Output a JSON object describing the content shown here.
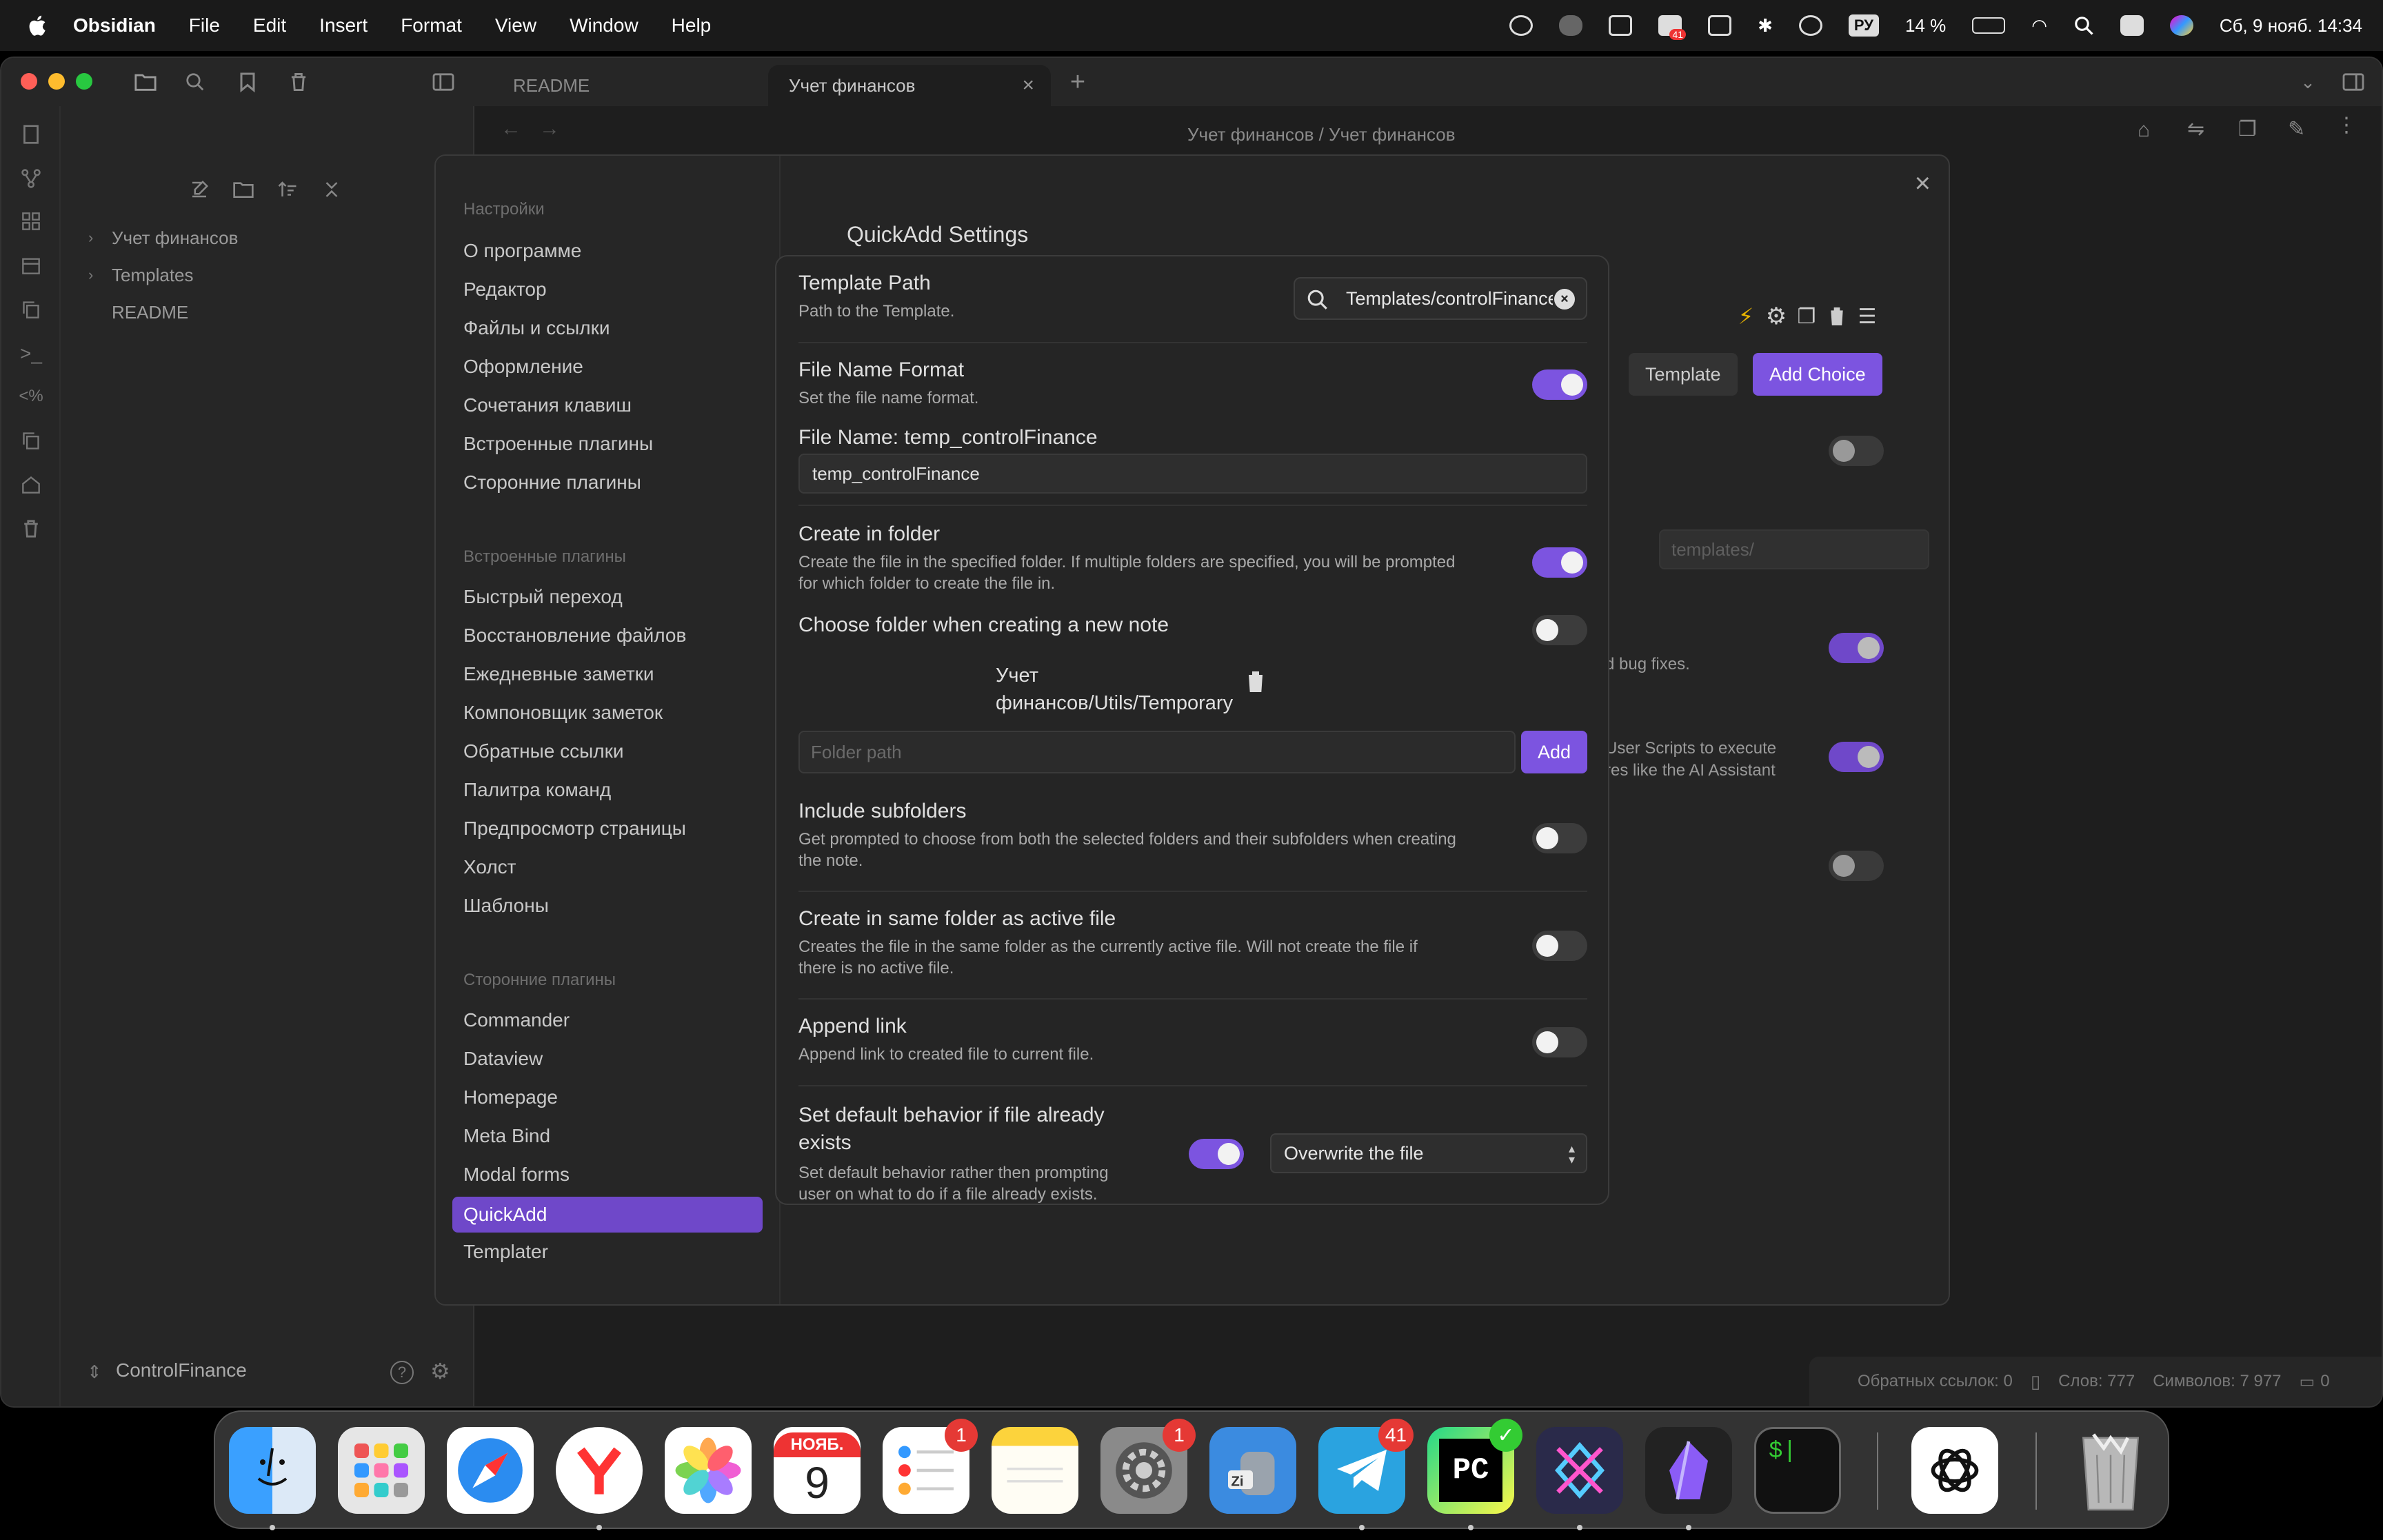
{
  "menubar": {
    "app": "Obsidian",
    "items": [
      "File",
      "Edit",
      "Insert",
      "Format",
      "View",
      "Window",
      "Help"
    ],
    "input_lang": "РУ",
    "battery": "14 %",
    "datetime": "Сб, 9 нояб.  14:34",
    "status_badge": "41"
  },
  "tabs": [
    {
      "label": "README",
      "active": false
    },
    {
      "label": "Учет финансов",
      "active": true
    }
  ],
  "breadcrumb": "Учет финансов  /  Учет финансов",
  "file_tree": {
    "items": [
      "Учет финансов",
      "Templates",
      "README"
    ],
    "vault": "ControlFinance"
  },
  "statusbar": {
    "backlinks": "Обратных ссылок: 0",
    "words": "Слов: 777",
    "chars": "Символов: 7 977",
    "comments": "0"
  },
  "settings": {
    "sections": [
      {
        "heading": "Настройки",
        "items": [
          "О программе",
          "Редактор",
          "Файлы и ссылки",
          "Оформление",
          "Сочетания клавиш",
          "Встроенные плагины",
          "Сторонние плагины"
        ]
      },
      {
        "heading": "Встроенные плагины",
        "items": [
          "Быстрый переход",
          "Восстановление файлов",
          "Ежедневные заметки",
          "Компоновщик заметок",
          "Обратные ссылки",
          "Палитра команд",
          "Предпросмотр страницы",
          "Холст",
          "Шаблоны"
        ]
      },
      {
        "heading": "Сторонние плагины",
        "items": [
          "Commander",
          "Dataview",
          "Homepage",
          "Meta Bind",
          "Modal forms",
          "QuickAdd",
          "Templater"
        ]
      }
    ],
    "active_item": "QuickAdd",
    "title": "QuickAdd Settings",
    "buttons": {
      "template": "Template",
      "add_choice": "Add Choice"
    },
    "templates_placeholder": "templates/",
    "bg_text_1": "d bug fixes.",
    "bg_text_2": "User Scripts to execute\nres like the AI Assistant"
  },
  "dialog": {
    "template_path": {
      "label": "Template Path",
      "desc": "Path to the Template.",
      "value": "Templates/controlFinance.md"
    },
    "file_name_format": {
      "label": "File Name Format",
      "desc": "Set the file name format.",
      "on": true
    },
    "file_name": {
      "label": "File Name: temp_controlFinance",
      "value": "temp_controlFinance"
    },
    "create_in_folder": {
      "label": "Create in folder",
      "desc": "Create the file in the specified folder. If multiple folders are specified, you will be prompted\nfor which folder to create the file in.",
      "on": true
    },
    "choose_folder": {
      "label": "Choose folder when creating a new note",
      "on": false
    },
    "folder_entry": "Учет финансов/Utils/Temporary",
    "folder_input_placeholder": "Folder path",
    "add_label": "Add",
    "include_subfolders": {
      "label": "Include subfolders",
      "desc": "Get prompted to choose from both the selected folders and their subfolders when creating\nthe note.",
      "on": false
    },
    "same_folder": {
      "label": "Create in same folder as active file",
      "desc": "Creates the file in the same folder as the currently active file. Will not create the file if\nthere is no active file.",
      "on": false
    },
    "append_link": {
      "label": "Append link",
      "desc": "Append link to created file to current file.",
      "on": false
    },
    "default_behavior": {
      "label": "Set default behavior if file already\nexists",
      "desc": "Set default behavior rather then prompting\nuser on what to do if a file already exists.",
      "on": true,
      "selected": "Overwrite the file"
    }
  },
  "dock": {
    "calendar_month": "НОЯБ.",
    "calendar_day": "9",
    "badges": {
      "reminders": "1",
      "settings": "1",
      "telegram": "41"
    }
  }
}
